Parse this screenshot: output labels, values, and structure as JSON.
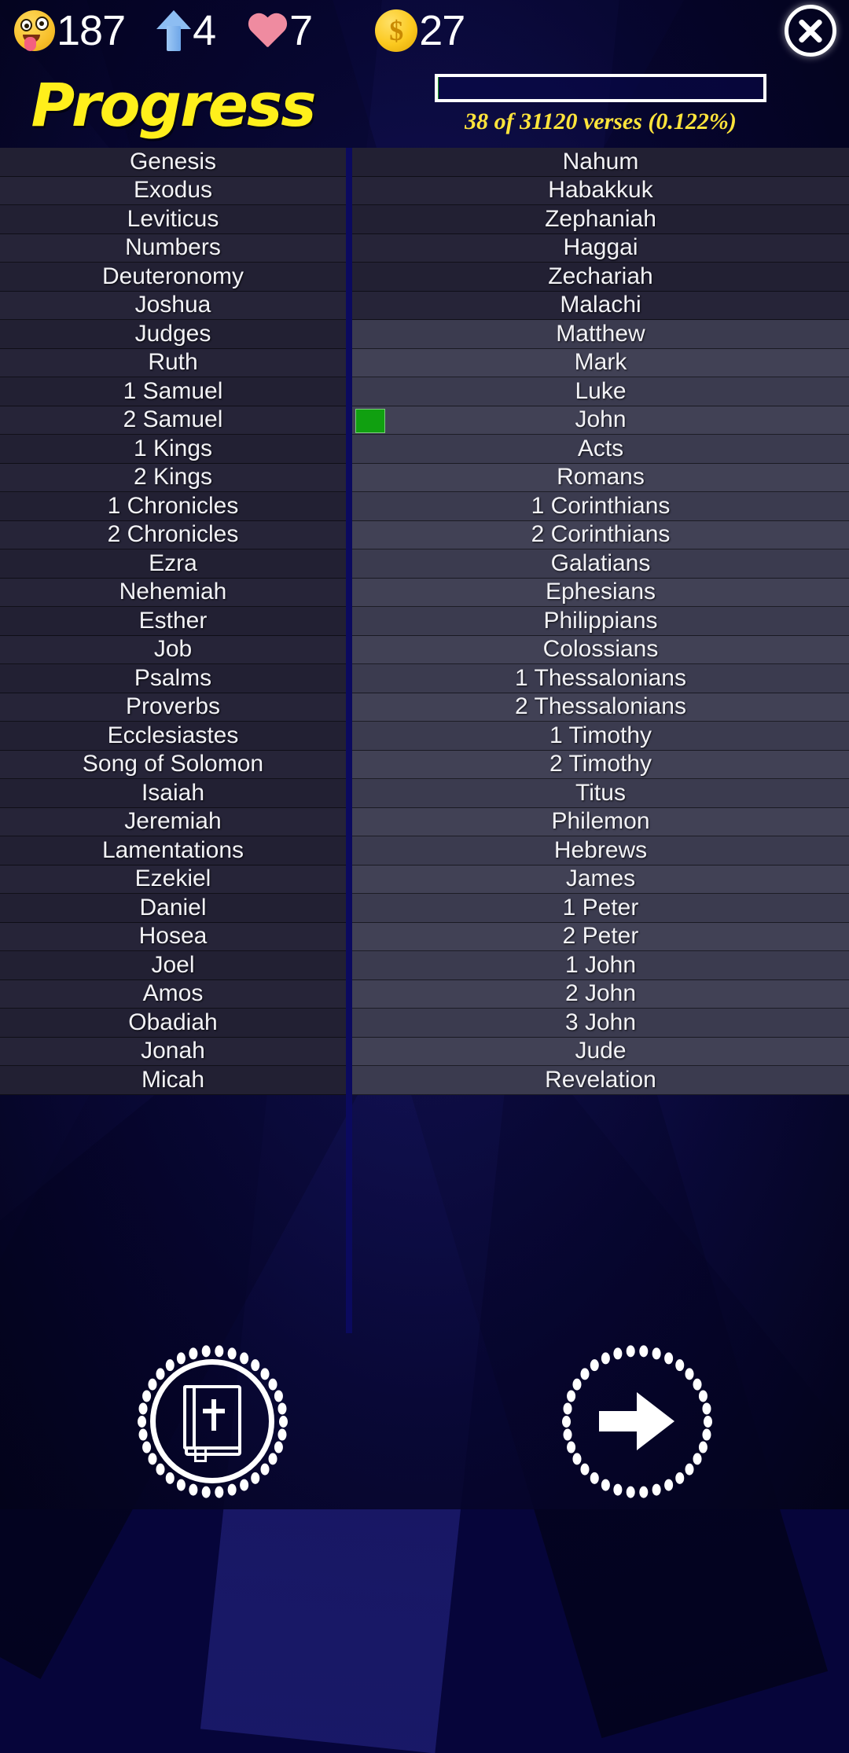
{
  "stats": {
    "face_icon": "smiling-face-with-tongue-icon",
    "face_value": "187",
    "level_icon": "up-arrow-icon",
    "level_value": "4",
    "hearts_icon": "heart-icon",
    "hearts_value": "7",
    "coins_icon": "coin-icon",
    "coins_value": "27",
    "close_icon": "close-icon"
  },
  "header": {
    "title": "Progress",
    "progress_text": "38 of 31120 verses (0.122%)",
    "progress_percent": 0.122,
    "verses_read": 38,
    "verses_total": 31120
  },
  "colors": {
    "title": "#ffef1b",
    "progress_text": "#ffe43b",
    "marker_green": "#10a010",
    "background": "#0a0a45",
    "row_old_testament": "#222033",
    "row_new_testament": "#3b3b4f"
  },
  "left_column": {
    "rows": [
      {
        "label": "Genesis",
        "testament": "old",
        "marked": false
      },
      {
        "label": "Exodus",
        "testament": "old",
        "marked": false
      },
      {
        "label": "Leviticus",
        "testament": "old",
        "marked": false
      },
      {
        "label": "Numbers",
        "testament": "old",
        "marked": false
      },
      {
        "label": "Deuteronomy",
        "testament": "old",
        "marked": false
      },
      {
        "label": "Joshua",
        "testament": "old",
        "marked": false
      },
      {
        "label": "Judges",
        "testament": "old",
        "marked": false
      },
      {
        "label": "Ruth",
        "testament": "old",
        "marked": false
      },
      {
        "label": "1 Samuel",
        "testament": "old",
        "marked": false
      },
      {
        "label": "2 Samuel",
        "testament": "old",
        "marked": false
      },
      {
        "label": "1 Kings",
        "testament": "old",
        "marked": false
      },
      {
        "label": "2 Kings",
        "testament": "old",
        "marked": false
      },
      {
        "label": "1 Chronicles",
        "testament": "old",
        "marked": false
      },
      {
        "label": "2 Chronicles",
        "testament": "old",
        "marked": false
      },
      {
        "label": "Ezra",
        "testament": "old",
        "marked": false
      },
      {
        "label": "Nehemiah",
        "testament": "old",
        "marked": false
      },
      {
        "label": "Esther",
        "testament": "old",
        "marked": false
      },
      {
        "label": "Job",
        "testament": "old",
        "marked": false
      },
      {
        "label": "Psalms",
        "testament": "old",
        "marked": false
      },
      {
        "label": "Proverbs",
        "testament": "old",
        "marked": false
      },
      {
        "label": "Ecclesiastes",
        "testament": "old",
        "marked": false
      },
      {
        "label": "Song of Solomon",
        "testament": "old",
        "marked": false
      },
      {
        "label": "Isaiah",
        "testament": "old",
        "marked": false
      },
      {
        "label": "Jeremiah",
        "testament": "old",
        "marked": false
      },
      {
        "label": "Lamentations",
        "testament": "old",
        "marked": false
      },
      {
        "label": "Ezekiel",
        "testament": "old",
        "marked": false
      },
      {
        "label": "Daniel",
        "testament": "old",
        "marked": false
      },
      {
        "label": "Hosea",
        "testament": "old",
        "marked": false
      },
      {
        "label": "Joel",
        "testament": "old",
        "marked": false
      },
      {
        "label": "Amos",
        "testament": "old",
        "marked": false
      },
      {
        "label": "Obadiah",
        "testament": "old",
        "marked": false
      },
      {
        "label": "Jonah",
        "testament": "old",
        "marked": false
      },
      {
        "label": "Micah",
        "testament": "old",
        "marked": false
      }
    ]
  },
  "right_column": {
    "rows": [
      {
        "label": "Nahum",
        "testament": "old",
        "marked": false
      },
      {
        "label": "Habakkuk",
        "testament": "old",
        "marked": false
      },
      {
        "label": "Zephaniah",
        "testament": "old",
        "marked": false
      },
      {
        "label": "Haggai",
        "testament": "old",
        "marked": false
      },
      {
        "label": "Zechariah",
        "testament": "old",
        "marked": false
      },
      {
        "label": "Malachi",
        "testament": "old",
        "marked": false
      },
      {
        "label": "Matthew",
        "testament": "new",
        "marked": false
      },
      {
        "label": "Mark",
        "testament": "new",
        "marked": false
      },
      {
        "label": "Luke",
        "testament": "new",
        "marked": false
      },
      {
        "label": "John",
        "testament": "new",
        "marked": true
      },
      {
        "label": "Acts",
        "testament": "new",
        "marked": false
      },
      {
        "label": "Romans",
        "testament": "new",
        "marked": false
      },
      {
        "label": "1 Corinthians",
        "testament": "new",
        "marked": false
      },
      {
        "label": "2 Corinthians",
        "testament": "new",
        "marked": false
      },
      {
        "label": "Galatians",
        "testament": "new",
        "marked": false
      },
      {
        "label": "Ephesians",
        "testament": "new",
        "marked": false
      },
      {
        "label": "Philippians",
        "testament": "new",
        "marked": false
      },
      {
        "label": "Colossians",
        "testament": "new",
        "marked": false
      },
      {
        "label": "1 Thessalonians",
        "testament": "new",
        "marked": false
      },
      {
        "label": "2 Thessalonians",
        "testament": "new",
        "marked": false
      },
      {
        "label": "1 Timothy",
        "testament": "new",
        "marked": false
      },
      {
        "label": "2 Timothy",
        "testament": "new",
        "marked": false
      },
      {
        "label": "Titus",
        "testament": "new",
        "marked": false
      },
      {
        "label": "Philemon",
        "testament": "new",
        "marked": false
      },
      {
        "label": "Hebrews",
        "testament": "new",
        "marked": false
      },
      {
        "label": "James",
        "testament": "new",
        "marked": false
      },
      {
        "label": "1 Peter",
        "testament": "new",
        "marked": false
      },
      {
        "label": "2 Peter",
        "testament": "new",
        "marked": false
      },
      {
        "label": "1 John",
        "testament": "new",
        "marked": false
      },
      {
        "label": "2 John",
        "testament": "new",
        "marked": false
      },
      {
        "label": "3 John",
        "testament": "new",
        "marked": false
      },
      {
        "label": "Jude",
        "testament": "new",
        "marked": false
      },
      {
        "label": "Revelation",
        "testament": "new",
        "marked": false
      }
    ]
  },
  "bottom_bar": {
    "bible_button_icon": "bible-book-icon",
    "next_button_icon": "right-arrow-icon"
  }
}
